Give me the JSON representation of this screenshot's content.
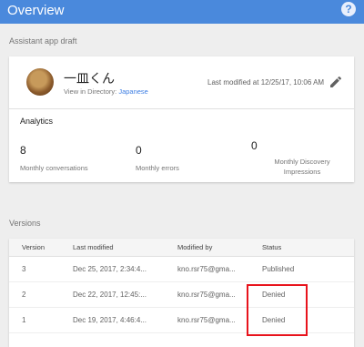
{
  "header": {
    "title": "Overview",
    "help_icon": "?"
  },
  "draft": {
    "section_label": "Assistant app draft",
    "app_name": "一皿くん",
    "view_in_directory_label": "View in Directory:",
    "directory_language": "Japanese",
    "last_modified": "Last modified at 12/25/17, 10:06 AM"
  },
  "analytics": {
    "title": "Analytics",
    "metrics": [
      {
        "value": "8",
        "label_line1": "Monthly conversations",
        "label_line2": ""
      },
      {
        "value": "0",
        "label_line1": "Monthly errors",
        "label_line2": ""
      },
      {
        "value": "0",
        "label_line1": "Monthly Discovery",
        "label_line2": "Impressions"
      }
    ]
  },
  "versions": {
    "section_label": "Versions",
    "columns": [
      "Version",
      "Last modified",
      "Modified by",
      "Status"
    ],
    "rows": [
      {
        "version": "3",
        "last_modified": "Dec 25, 2017, 2:34:4...",
        "modified_by": "kno.rsr75@gma...",
        "status": "Published"
      },
      {
        "version": "2",
        "last_modified": "Dec 22, 2017, 12:45:...",
        "modified_by": "kno.rsr75@gma...",
        "status": "Denied"
      },
      {
        "version": "1",
        "last_modified": "Dec 19, 2017, 4:46:4...",
        "modified_by": "kno.rsr75@gma...",
        "status": "Denied"
      }
    ]
  },
  "colors": {
    "header_bg": "#4a89dc",
    "link": "#3d7ee3",
    "annotation": "#e8131c"
  }
}
